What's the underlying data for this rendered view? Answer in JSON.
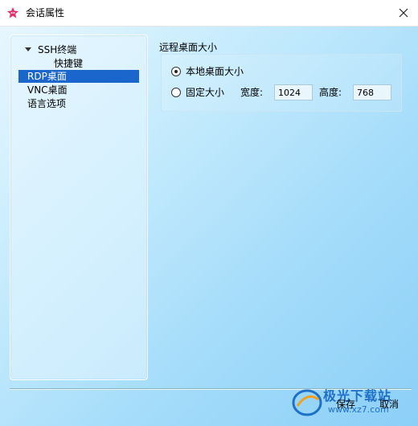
{
  "window": {
    "title": "会话属性"
  },
  "tree": {
    "items": [
      {
        "label": "SSH终端",
        "expanded": true
      },
      {
        "label": "快捷键"
      },
      {
        "label": "RDP桌面",
        "selected": true
      },
      {
        "label": "VNC桌面"
      },
      {
        "label": "语言选项"
      }
    ]
  },
  "rdp": {
    "group_title": "远程桌面大小",
    "option_local": "本地桌面大小",
    "option_fixed": "固定大小",
    "selected_option": "本地桌面大小",
    "width_label": "宽度:",
    "width_value": "1024",
    "height_label": "高度:",
    "height_value": "768"
  },
  "buttons": {
    "save": "保存",
    "cancel": "取消"
  },
  "watermark": {
    "text": "极光下载站",
    "url": "www.xz7.com"
  },
  "colors": {
    "selection": "#1a66cc",
    "accent": "#e0306d"
  }
}
